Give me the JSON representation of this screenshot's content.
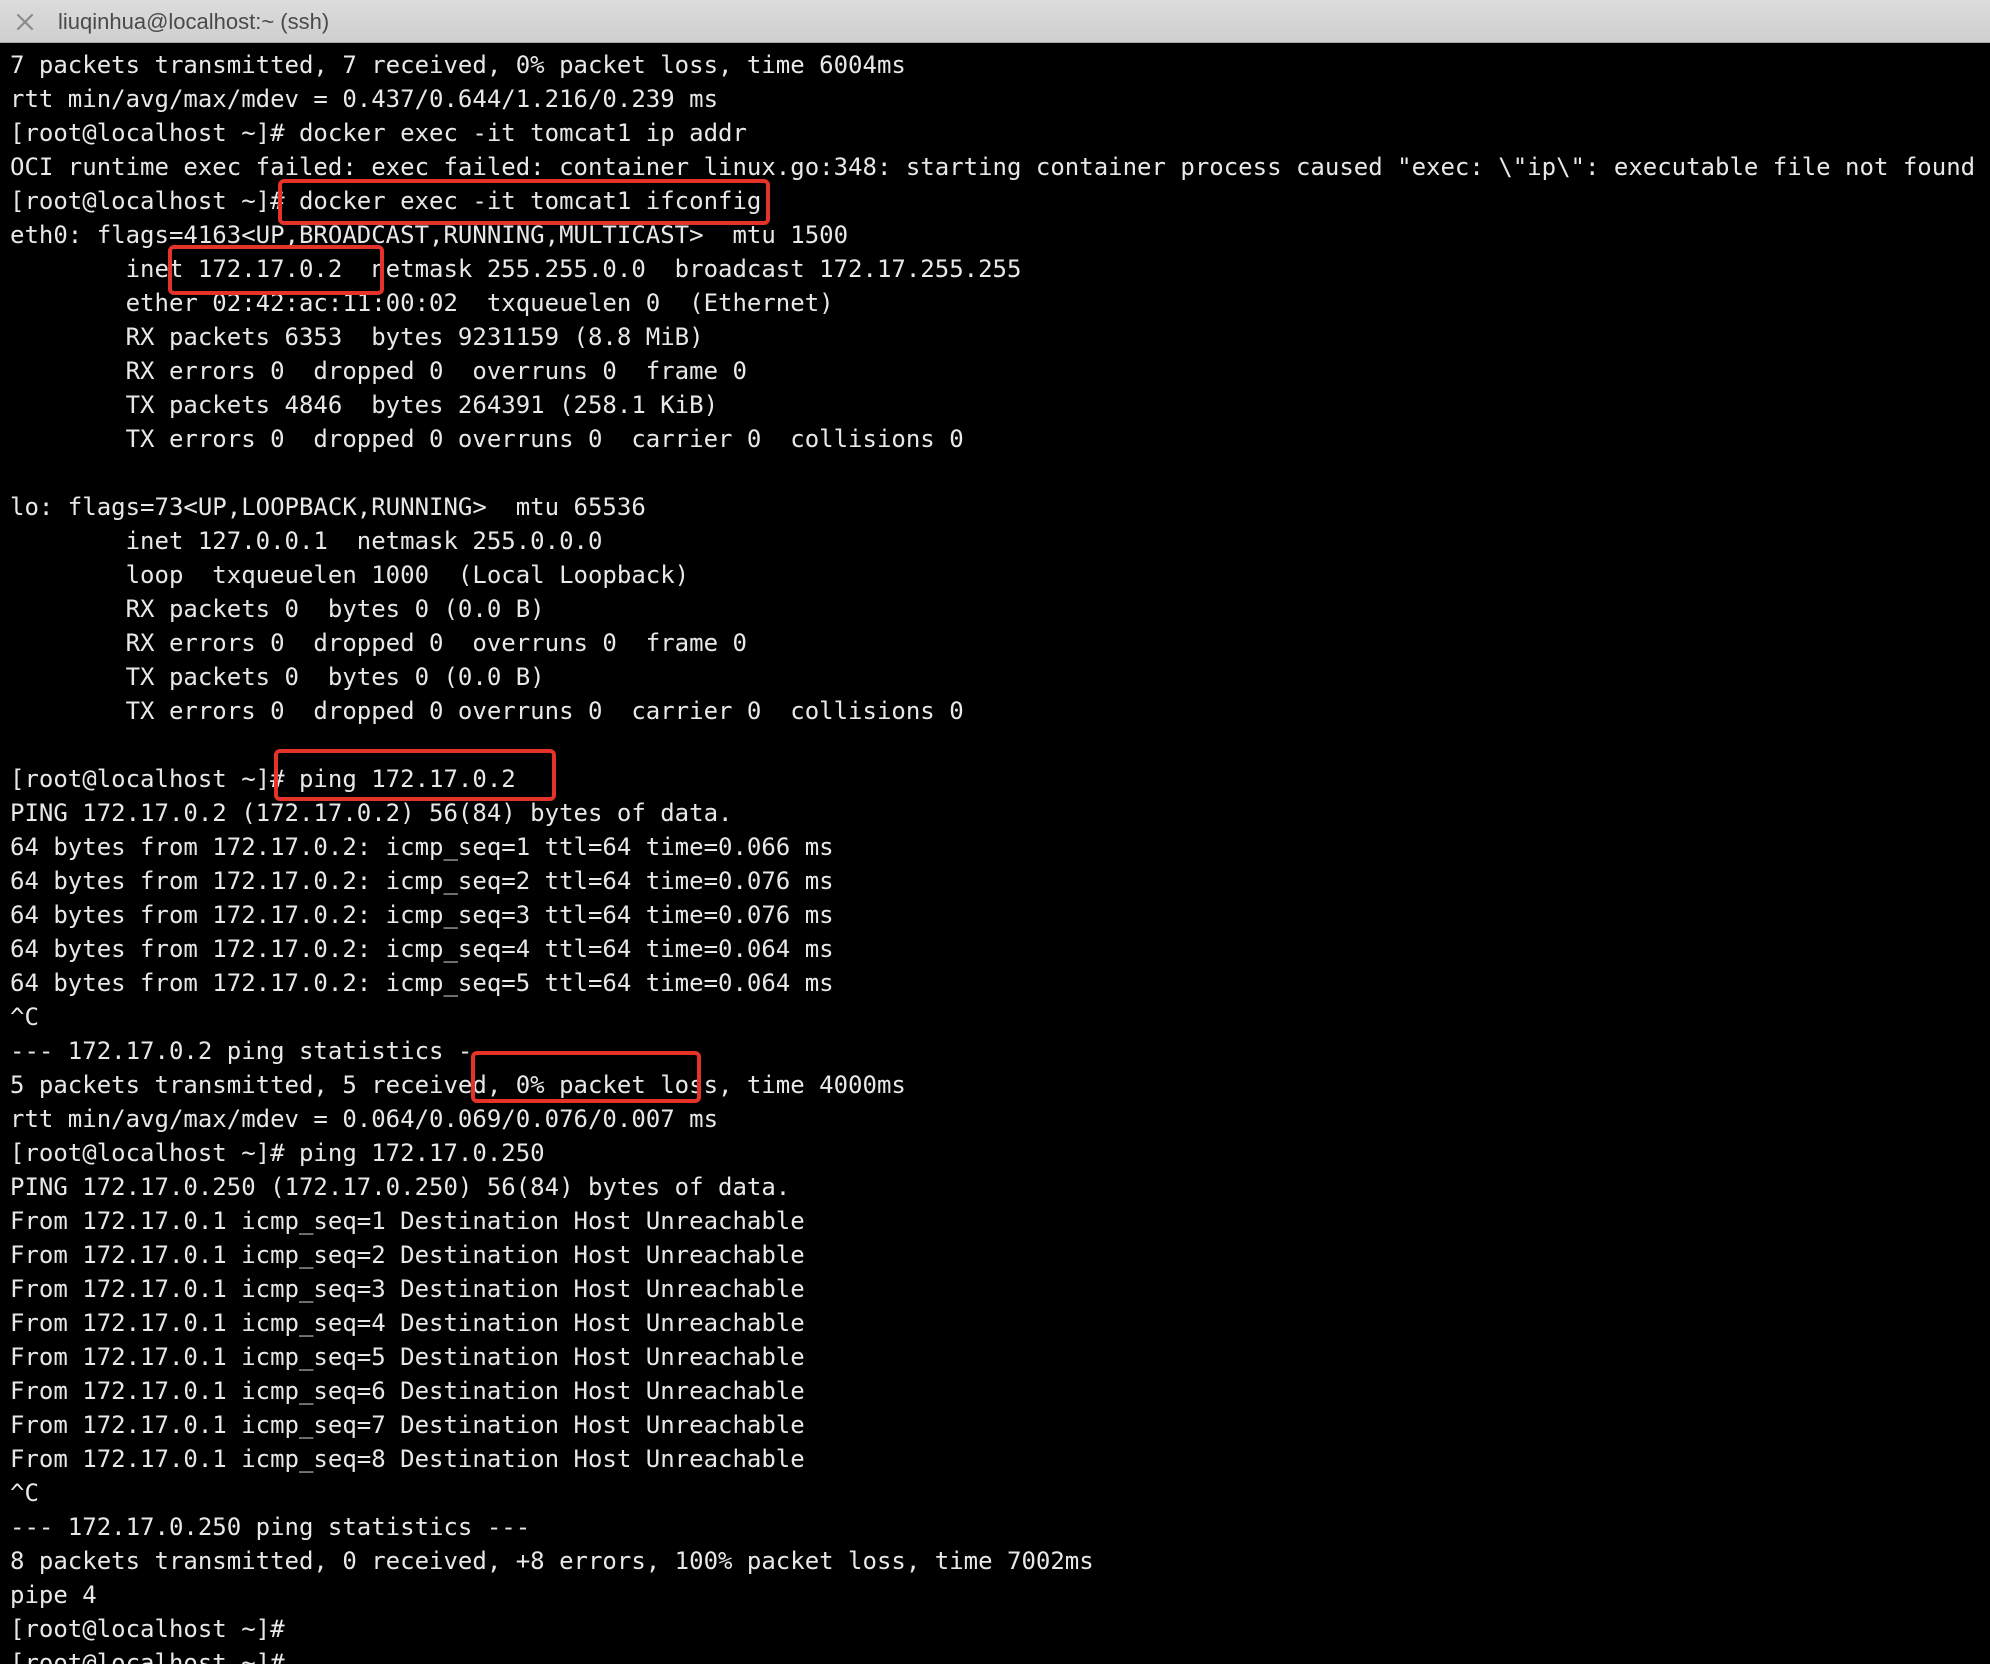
{
  "window": {
    "title": "liuqinhua@localhost:~ (ssh)",
    "close_icon": "close-icon"
  },
  "terminal": {
    "lines": [
      "7 packets transmitted, 7 received, 0% packet loss, time 6004ms",
      "rtt min/avg/max/mdev = 0.437/0.644/1.216/0.239 ms",
      "[root@localhost ~]# docker exec -it tomcat1 ip addr",
      "OCI runtime exec failed: exec failed: container_linux.go:348: starting container process caused \"exec: \\\"ip\\\": executable file not found in $P",
      "[root@localhost ~]# docker exec -it tomcat1 ifconfig",
      "eth0: flags=4163<UP,BROADCAST,RUNNING,MULTICAST>  mtu 1500",
      "        inet 172.17.0.2  netmask 255.255.0.0  broadcast 172.17.255.255",
      "        ether 02:42:ac:11:00:02  txqueuelen 0  (Ethernet)",
      "        RX packets 6353  bytes 9231159 (8.8 MiB)",
      "        RX errors 0  dropped 0  overruns 0  frame 0",
      "        TX packets 4846  bytes 264391 (258.1 KiB)",
      "        TX errors 0  dropped 0 overruns 0  carrier 0  collisions 0",
      "",
      "lo: flags=73<UP,LOOPBACK,RUNNING>  mtu 65536",
      "        inet 127.0.0.1  netmask 255.0.0.0",
      "        loop  txqueuelen 1000  (Local Loopback)",
      "        RX packets 0  bytes 0 (0.0 B)",
      "        RX errors 0  dropped 0  overruns 0  frame 0",
      "        TX packets 0  bytes 0 (0.0 B)",
      "        TX errors 0  dropped 0 overruns 0  carrier 0  collisions 0",
      "",
      "[root@localhost ~]# ping 172.17.0.2",
      "PING 172.17.0.2 (172.17.0.2) 56(84) bytes of data.",
      "64 bytes from 172.17.0.2: icmp_seq=1 ttl=64 time=0.066 ms",
      "64 bytes from 172.17.0.2: icmp_seq=2 ttl=64 time=0.076 ms",
      "64 bytes from 172.17.0.2: icmp_seq=3 ttl=64 time=0.076 ms",
      "64 bytes from 172.17.0.2: icmp_seq=4 ttl=64 time=0.064 ms",
      "64 bytes from 172.17.0.2: icmp_seq=5 ttl=64 time=0.064 ms",
      "^C",
      "--- 172.17.0.2 ping statistics ---",
      "5 packets transmitted, 5 received, 0% packet loss, time 4000ms",
      "rtt min/avg/max/mdev = 0.064/0.069/0.076/0.007 ms",
      "[root@localhost ~]# ping 172.17.0.250",
      "PING 172.17.0.250 (172.17.0.250) 56(84) bytes of data.",
      "From 172.17.0.1 icmp_seq=1 Destination Host Unreachable",
      "From 172.17.0.1 icmp_seq=2 Destination Host Unreachable",
      "From 172.17.0.1 icmp_seq=3 Destination Host Unreachable",
      "From 172.17.0.1 icmp_seq=4 Destination Host Unreachable",
      "From 172.17.0.1 icmp_seq=5 Destination Host Unreachable",
      "From 172.17.0.1 icmp_seq=6 Destination Host Unreachable",
      "From 172.17.0.1 icmp_seq=7 Destination Host Unreachable",
      "From 172.17.0.1 icmp_seq=8 Destination Host Unreachable",
      "^C",
      "--- 172.17.0.250 ping statistics ---",
      "8 packets transmitted, 0 received, +8 errors, 100% packet loss, time 7002ms",
      "pipe 4",
      "[root@localhost ~]#",
      "[root@localhost ~]#"
    ]
  },
  "colors": {
    "background": "#000000",
    "text": "#e8e8e8",
    "highlight": "#e5332a",
    "titlebar": "#d6d6d6"
  }
}
